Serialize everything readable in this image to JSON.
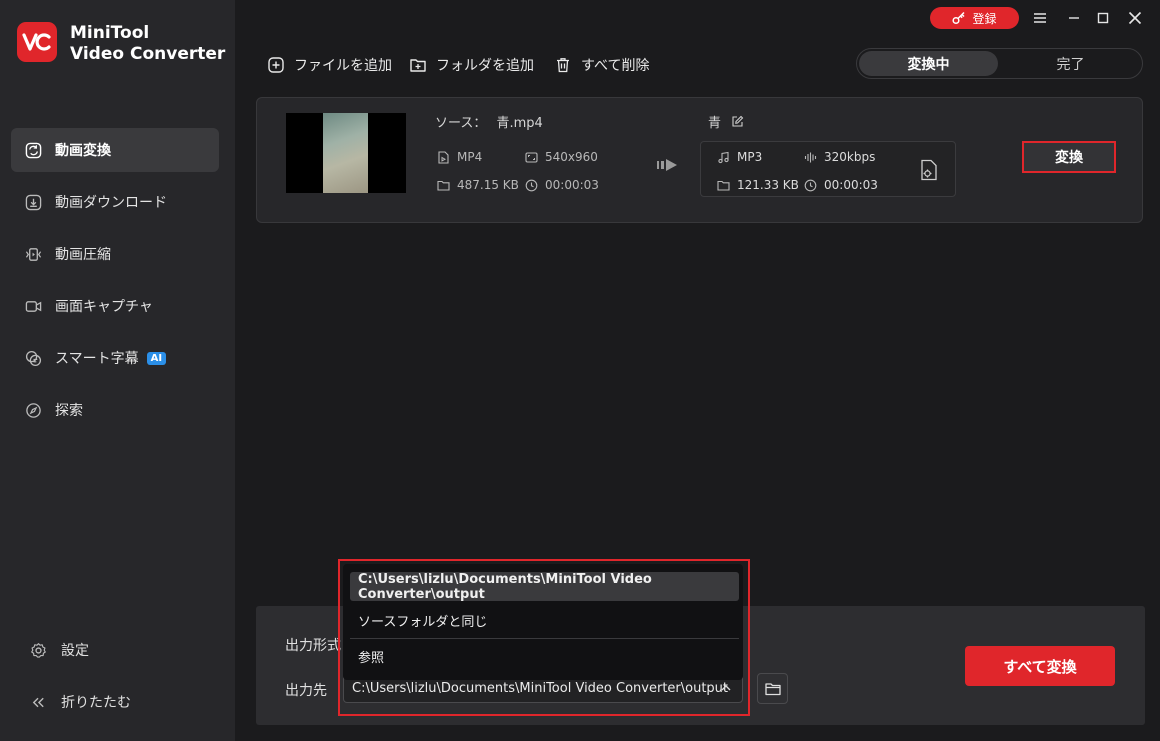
{
  "app": {
    "name_line1": "MiniTool",
    "name_line2": "Video Converter",
    "register_label": "登録"
  },
  "sidebar": {
    "items": [
      {
        "label": "動画変換",
        "icon": "convert-icon",
        "active": true
      },
      {
        "label": "動画ダウンロード",
        "icon": "download-icon",
        "active": false
      },
      {
        "label": "動画圧縮",
        "icon": "compress-icon",
        "active": false
      },
      {
        "label": "画面キャプチャ",
        "icon": "camera-icon",
        "active": false
      },
      {
        "label": "スマート字幕",
        "icon": "subtitle-icon",
        "active": false,
        "badge": "AI"
      },
      {
        "label": "探索",
        "icon": "compass-icon",
        "active": false
      }
    ],
    "settings_label": "設定",
    "collapse_label": "折りたたむ"
  },
  "toolbar": {
    "add_file": "ファイルを追加",
    "add_folder": "フォルダを追加",
    "delete_all": "すべて削除"
  },
  "tabs": {
    "converting": "変換中",
    "done": "完了"
  },
  "file": {
    "source_label": "ソース：",
    "source_name": "青.mp4",
    "format": "MP4",
    "resolution": "540x960",
    "size": "487.15 KB",
    "duration": "00:00:03",
    "target_name": "青",
    "target_format": "MP3",
    "target_bitrate": "320kbps",
    "target_size": "121.33 KB",
    "target_duration": "00:00:03",
    "convert_label": "変換"
  },
  "bottom": {
    "output_format_label": "出力形式",
    "output_dest_label": "出力先",
    "output_path": "C:\\Users\\lizlu\\Documents\\MiniTool Video Converter\\output",
    "convert_all_label": "すべて変換"
  },
  "dropdown": {
    "options": [
      "C:\\Users\\lizlu\\Documents\\MiniTool Video Converter\\output",
      "ソースフォルダと同じ",
      "参照"
    ]
  },
  "colors": {
    "accent": "#e0262b",
    "sidebar_bg": "#27272a",
    "main_bg": "#1b1b1d",
    "ai_badge": "#2b8fe8"
  }
}
